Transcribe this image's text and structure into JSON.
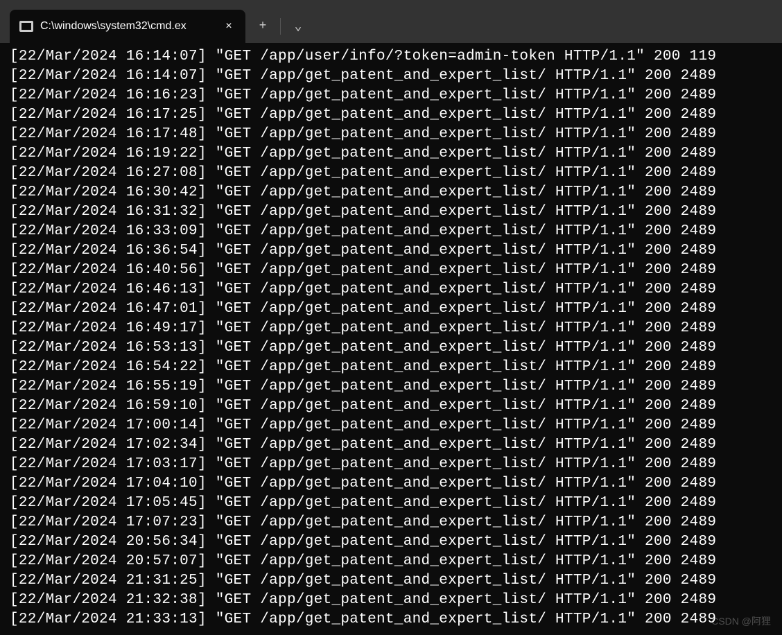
{
  "titlebar": {
    "tab_title": "C:\\windows\\system32\\cmd.ex",
    "close_label": "×",
    "new_tab_label": "+",
    "dropdown_label": "⌄"
  },
  "watermark": "CSDN @阿狸",
  "log_lines": [
    "[22/Mar/2024 16:14:07] \"GET /app/user/info/?token=admin-token HTTP/1.1\" 200 119",
    "[22/Mar/2024 16:14:07] \"GET /app/get_patent_and_expert_list/ HTTP/1.1\" 200 2489",
    "[22/Mar/2024 16:16:23] \"GET /app/get_patent_and_expert_list/ HTTP/1.1\" 200 2489",
    "[22/Mar/2024 16:17:25] \"GET /app/get_patent_and_expert_list/ HTTP/1.1\" 200 2489",
    "[22/Mar/2024 16:17:48] \"GET /app/get_patent_and_expert_list/ HTTP/1.1\" 200 2489",
    "[22/Mar/2024 16:19:22] \"GET /app/get_patent_and_expert_list/ HTTP/1.1\" 200 2489",
    "[22/Mar/2024 16:27:08] \"GET /app/get_patent_and_expert_list/ HTTP/1.1\" 200 2489",
    "[22/Mar/2024 16:30:42] \"GET /app/get_patent_and_expert_list/ HTTP/1.1\" 200 2489",
    "[22/Mar/2024 16:31:32] \"GET /app/get_patent_and_expert_list/ HTTP/1.1\" 200 2489",
    "[22/Mar/2024 16:33:09] \"GET /app/get_patent_and_expert_list/ HTTP/1.1\" 200 2489",
    "[22/Mar/2024 16:36:54] \"GET /app/get_patent_and_expert_list/ HTTP/1.1\" 200 2489",
    "[22/Mar/2024 16:40:56] \"GET /app/get_patent_and_expert_list/ HTTP/1.1\" 200 2489",
    "[22/Mar/2024 16:46:13] \"GET /app/get_patent_and_expert_list/ HTTP/1.1\" 200 2489",
    "[22/Mar/2024 16:47:01] \"GET /app/get_patent_and_expert_list/ HTTP/1.1\" 200 2489",
    "[22/Mar/2024 16:49:17] \"GET /app/get_patent_and_expert_list/ HTTP/1.1\" 200 2489",
    "[22/Mar/2024 16:53:13] \"GET /app/get_patent_and_expert_list/ HTTP/1.1\" 200 2489",
    "[22/Mar/2024 16:54:22] \"GET /app/get_patent_and_expert_list/ HTTP/1.1\" 200 2489",
    "[22/Mar/2024 16:55:19] \"GET /app/get_patent_and_expert_list/ HTTP/1.1\" 200 2489",
    "[22/Mar/2024 16:59:10] \"GET /app/get_patent_and_expert_list/ HTTP/1.1\" 200 2489",
    "[22/Mar/2024 17:00:14] \"GET /app/get_patent_and_expert_list/ HTTP/1.1\" 200 2489",
    "[22/Mar/2024 17:02:34] \"GET /app/get_patent_and_expert_list/ HTTP/1.1\" 200 2489",
    "[22/Mar/2024 17:03:17] \"GET /app/get_patent_and_expert_list/ HTTP/1.1\" 200 2489",
    "[22/Mar/2024 17:04:10] \"GET /app/get_patent_and_expert_list/ HTTP/1.1\" 200 2489",
    "[22/Mar/2024 17:05:45] \"GET /app/get_patent_and_expert_list/ HTTP/1.1\" 200 2489",
    "[22/Mar/2024 17:07:23] \"GET /app/get_patent_and_expert_list/ HTTP/1.1\" 200 2489",
    "[22/Mar/2024 20:56:34] \"GET /app/get_patent_and_expert_list/ HTTP/1.1\" 200 2489",
    "[22/Mar/2024 20:57:07] \"GET /app/get_patent_and_expert_list/ HTTP/1.1\" 200 2489",
    "[22/Mar/2024 21:31:25] \"GET /app/get_patent_and_expert_list/ HTTP/1.1\" 200 2489",
    "[22/Mar/2024 21:32:38] \"GET /app/get_patent_and_expert_list/ HTTP/1.1\" 200 2489",
    "[22/Mar/2024 21:33:13] \"GET /app/get_patent_and_expert_list/ HTTP/1.1\" 200 2489"
  ]
}
